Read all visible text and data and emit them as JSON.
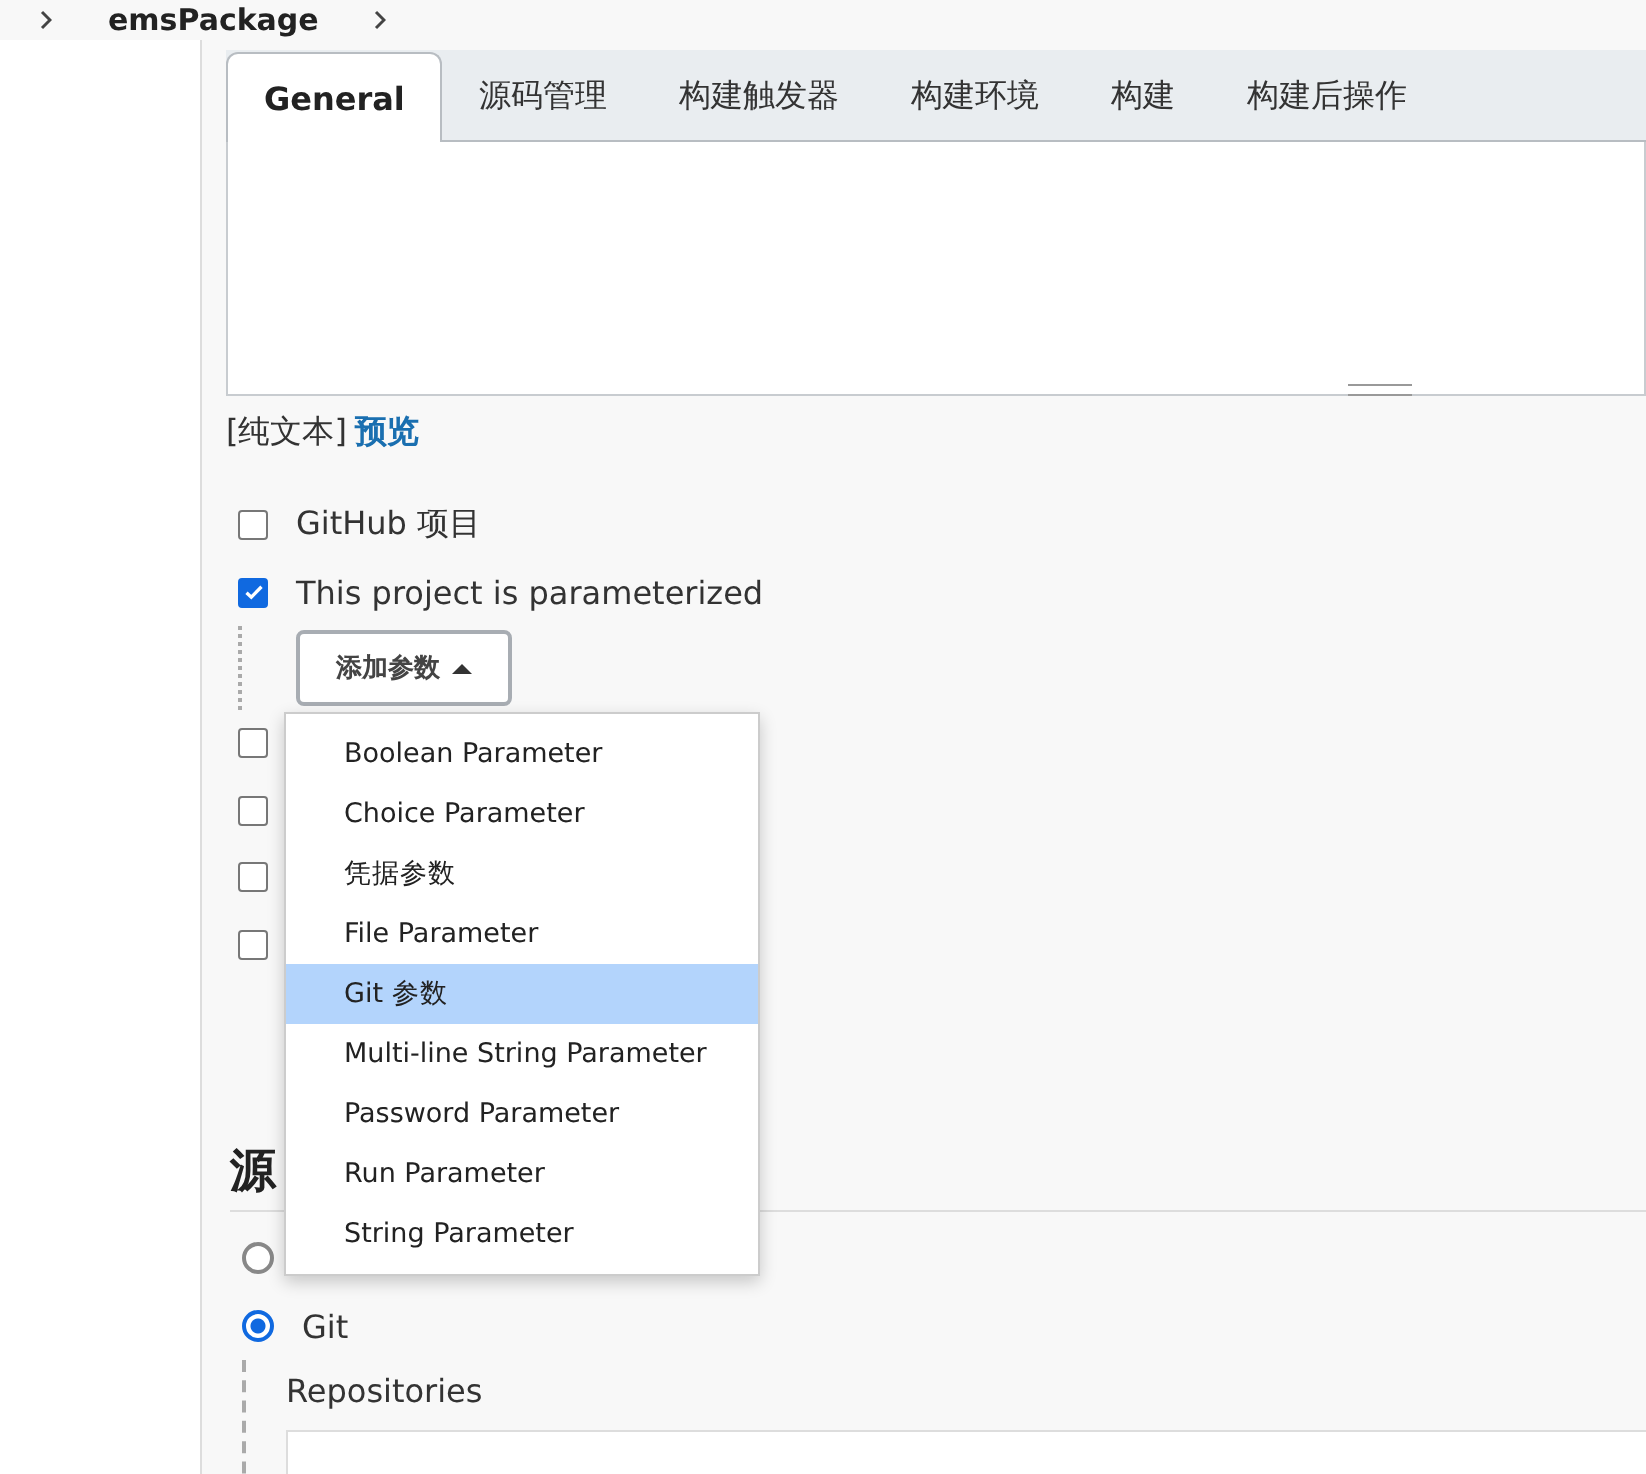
{
  "breadcrumb": {
    "item": "emsPackage"
  },
  "tabs": [
    {
      "label": "General",
      "selected": true
    },
    {
      "label": "源码管理",
      "selected": false
    },
    {
      "label": "构建触发器",
      "selected": false
    },
    {
      "label": "构建环境",
      "selected": false
    },
    {
      "label": "构建",
      "selected": false
    },
    {
      "label": "构建后操作",
      "selected": false
    }
  ],
  "format": {
    "plain": "[纯文本]",
    "preview": "预览"
  },
  "options": [
    {
      "label": "GitHub 项目",
      "checked": false
    },
    {
      "label": "This project is parameterized",
      "checked": true
    }
  ],
  "add_button": {
    "label": "添加参数"
  },
  "hidden_options": [
    {
      "checked": false
    },
    {
      "checked": false
    },
    {
      "checked": false
    },
    {
      "checked": false
    }
  ],
  "menu": [
    {
      "label": "Boolean Parameter",
      "selected": false
    },
    {
      "label": "Choice Parameter",
      "selected": false
    },
    {
      "label": "凭据参数",
      "selected": false
    },
    {
      "label": "File Parameter",
      "selected": false
    },
    {
      "label": "Git 参数",
      "selected": true
    },
    {
      "label": "Multi-line String Parameter",
      "selected": false
    },
    {
      "label": "Password Parameter",
      "selected": false
    },
    {
      "label": "Run Parameter",
      "selected": false
    },
    {
      "label": "String Parameter",
      "selected": false
    }
  ],
  "scm": {
    "heading": "源",
    "choices": [
      {
        "selected": false
      },
      {
        "label": "Git",
        "selected": true
      }
    ],
    "repositories": "Repositories"
  }
}
